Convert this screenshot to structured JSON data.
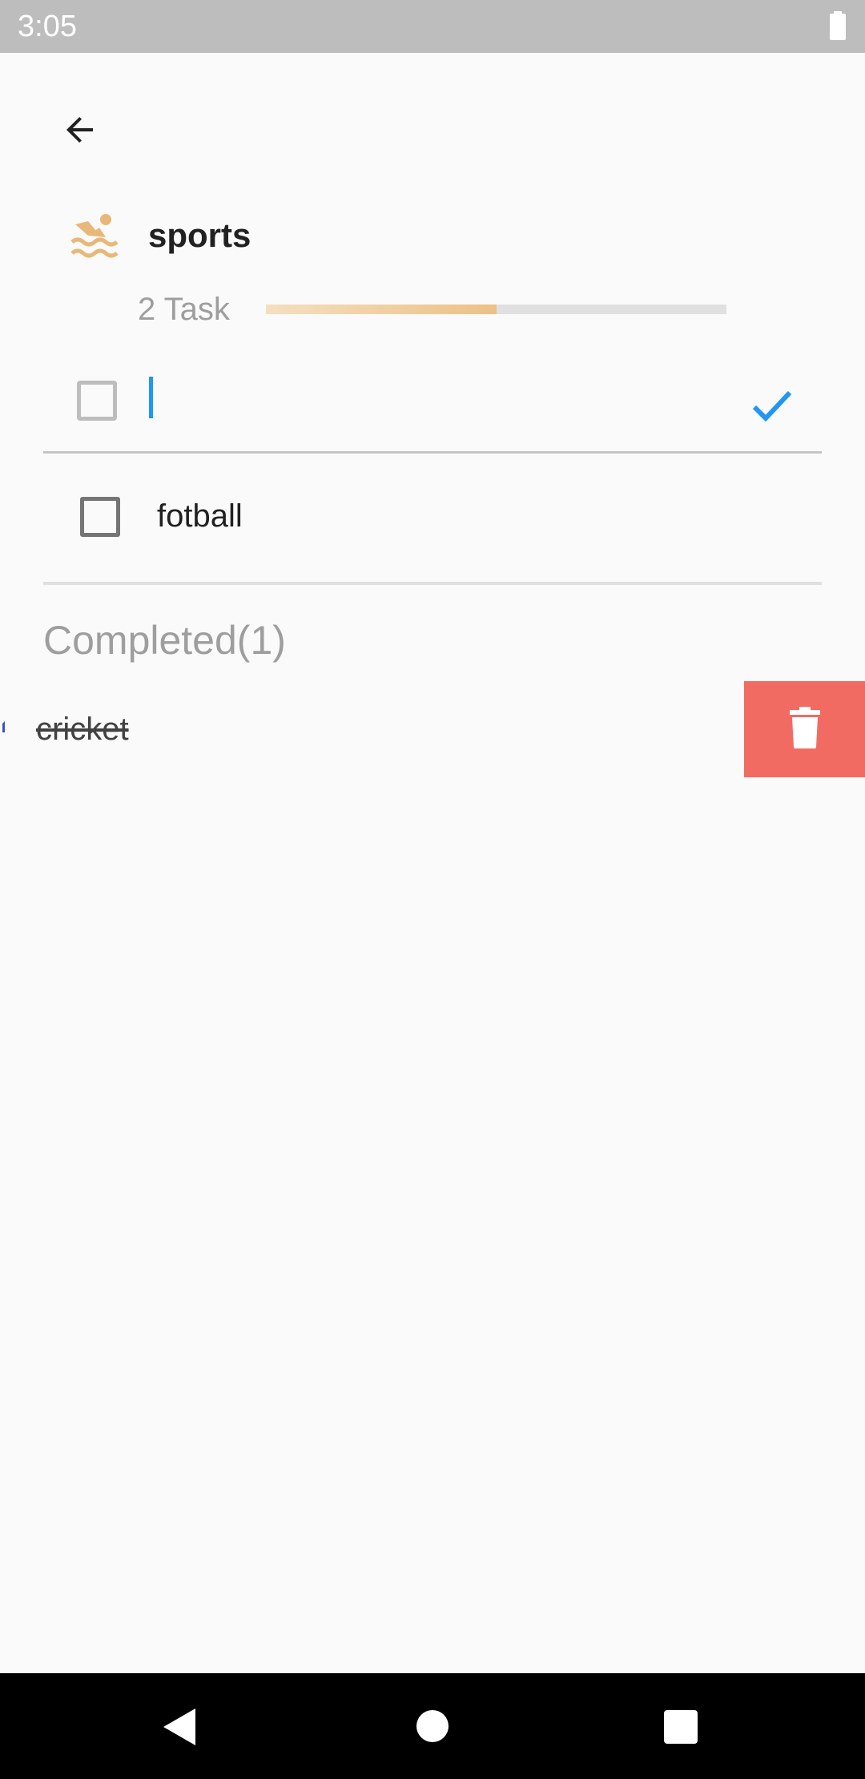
{
  "status_bar": {
    "time": "3:05",
    "battery_icon": "battery-full-icon"
  },
  "header": {
    "back_icon": "arrow-back-icon",
    "category_icon": "swimming-icon",
    "category_name": "sports",
    "category_color": "#e8b87a",
    "task_count": "2 Task",
    "progress_fraction": 0.5
  },
  "new_task": {
    "value": "",
    "placeholder": "",
    "confirm_icon": "check-icon",
    "accent_color": "#2196f3"
  },
  "tasks": [
    {
      "label": "fotball",
      "checked": false
    }
  ],
  "completed": {
    "header": "Completed(1)",
    "items": [
      {
        "label": "cricket",
        "checked": true
      }
    ],
    "delete_icon": "trash-icon",
    "delete_color": "#f26b63"
  },
  "nav_bar": {
    "back_icon": "nav-back-icon",
    "home_icon": "nav-home-icon",
    "recents_icon": "nav-recents-icon"
  }
}
